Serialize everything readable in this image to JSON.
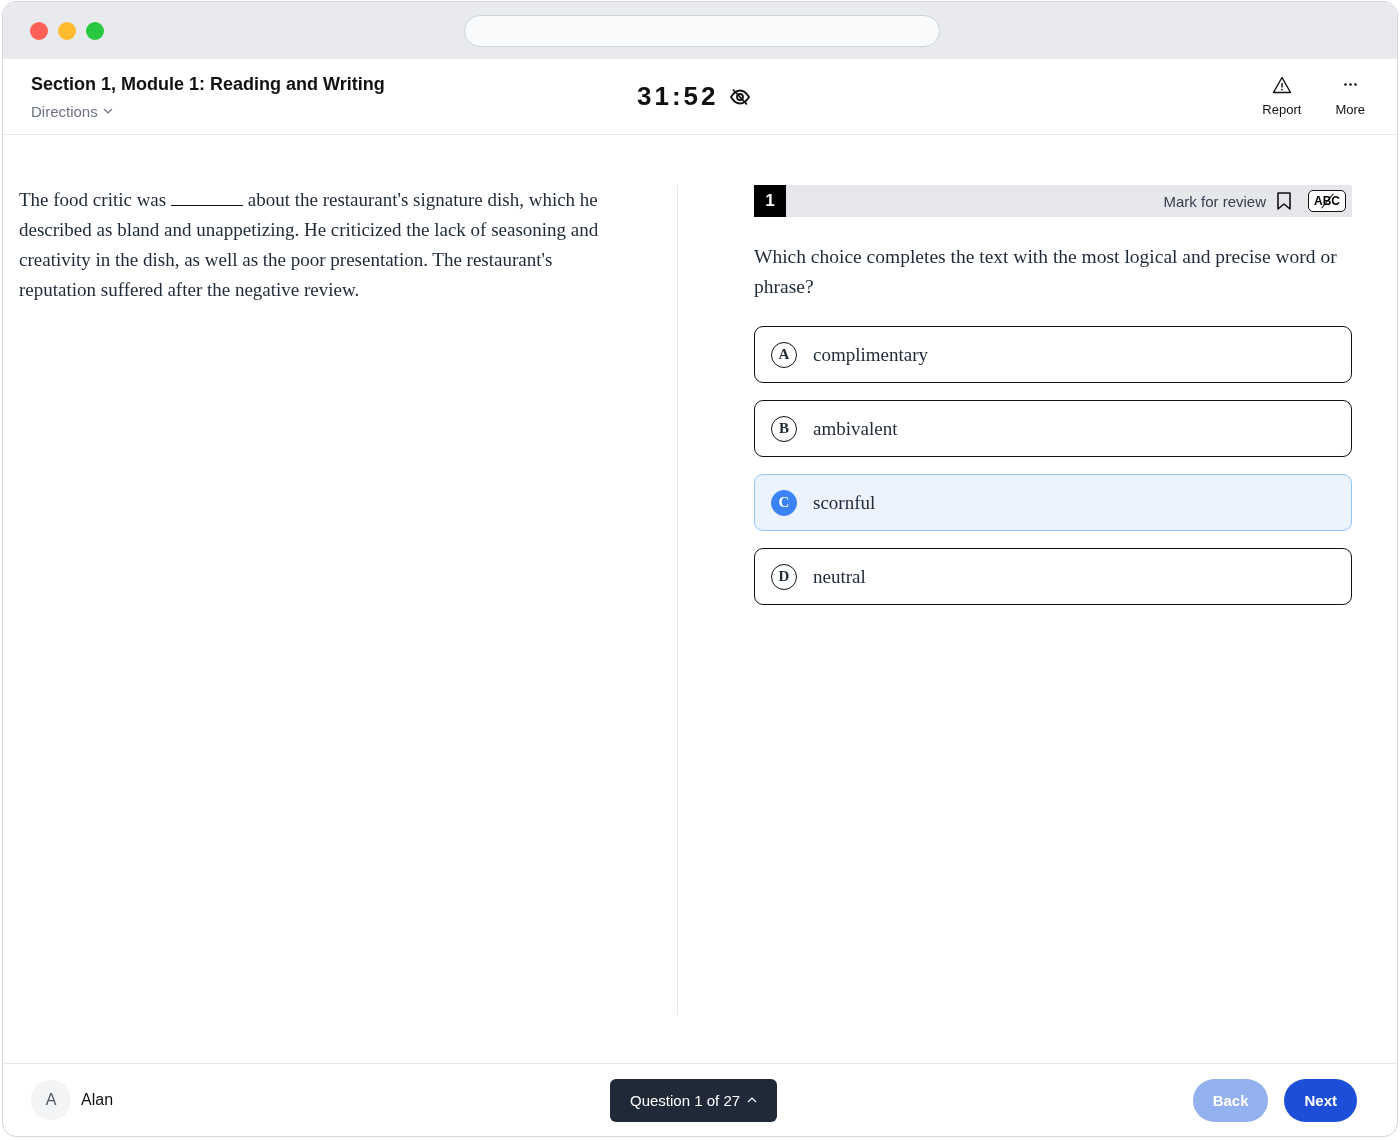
{
  "header": {
    "section_title": "Section 1, Module 1: Reading and Writing",
    "directions": "Directions",
    "timer": "31:52",
    "actions": [
      {
        "kind": "report",
        "label": "Report"
      },
      {
        "kind": "more",
        "label": "More"
      }
    ]
  },
  "passage": {
    "before": "The food critic was",
    "after": "about the restaurant's signature dish, which he described as bland and unappetizing. He criticized the lack of seasoning and creativity in the dish, as well as the poor presentation. The restaurant's reputation suffered after the negative review."
  },
  "question": {
    "number": "1",
    "mark_for_review": "Mark for review",
    "eliminator": "ABC",
    "prompt": "Which choice completes the text with the most logical and precise word or phrase?",
    "choices": [
      {
        "letter": "A",
        "text": "complimentary",
        "selected": false
      },
      {
        "letter": "B",
        "text": "ambivalent",
        "selected": false
      },
      {
        "letter": "C",
        "text": "scornful",
        "selected": true
      },
      {
        "letter": "D",
        "text": "neutral",
        "selected": false
      }
    ]
  },
  "footer": {
    "user_initial": "A",
    "user_name": "Alan",
    "progress": "Question 1 of 27",
    "back": {
      "label": "Back",
      "disabled": true
    },
    "next": {
      "label": "Next",
      "disabled": false
    }
  }
}
